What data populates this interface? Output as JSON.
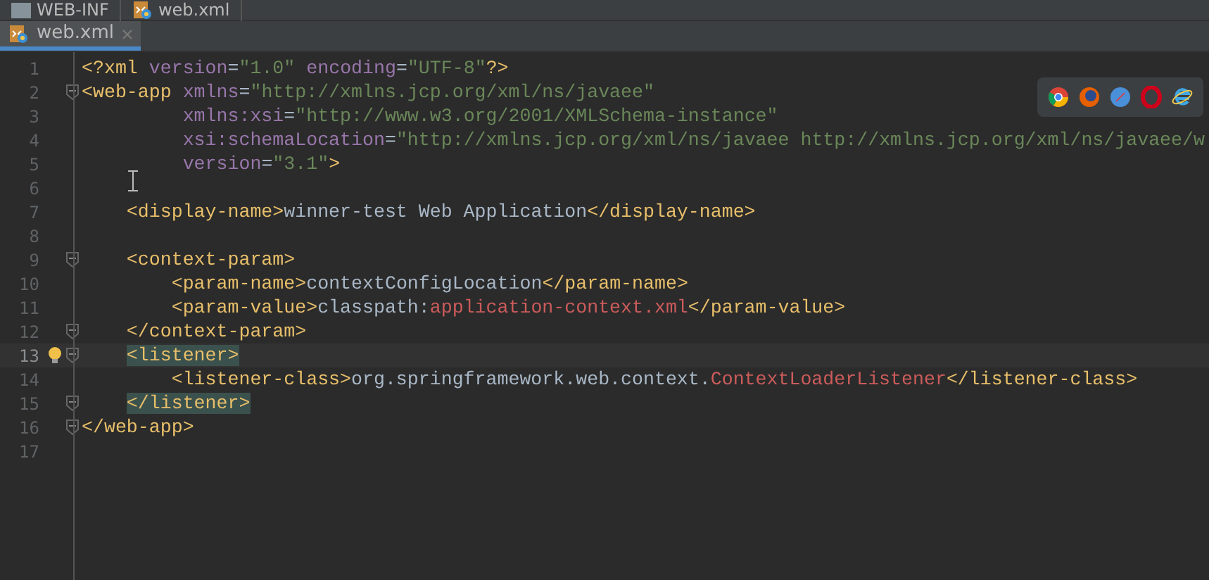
{
  "breadcrumbs": [
    {
      "label": "WEB-INF",
      "kind": "folder"
    },
    {
      "label": "web.xml",
      "kind": "file"
    }
  ],
  "tabs": [
    {
      "label": "web.xml",
      "selected": true
    }
  ],
  "lines": [
    {
      "number": "1",
      "fold": false,
      "current": false,
      "tokens": [
        {
          "kind": "tag",
          "text": "<?xml "
        },
        {
          "kind": "attr",
          "text": "version"
        },
        {
          "kind": "text",
          "text": "="
        },
        {
          "kind": "string",
          "text": "\"1.0\" "
        },
        {
          "kind": "attr",
          "text": "encoding"
        },
        {
          "kind": "text",
          "text": "="
        },
        {
          "kind": "string",
          "text": "\"UTF-8\""
        },
        {
          "kind": "tag",
          "text": "?>"
        }
      ]
    },
    {
      "number": "2",
      "fold": true,
      "current": false,
      "tokens": [
        {
          "kind": "tag",
          "text": "<web-app "
        },
        {
          "kind": "attr",
          "text": "xmlns"
        },
        {
          "kind": "text",
          "text": "="
        },
        {
          "kind": "string",
          "text": "\"http://xmlns.jcp.org/xml/ns/javaee\""
        }
      ]
    },
    {
      "number": "3",
      "fold": false,
      "current": false,
      "tokens": [
        {
          "kind": "attr",
          "text": "         xmlns:xsi"
        },
        {
          "kind": "text",
          "text": "="
        },
        {
          "kind": "string",
          "text": "\"http://www.w3.org/2001/XMLSchema-instance\""
        }
      ]
    },
    {
      "number": "4",
      "fold": false,
      "current": false,
      "tokens": [
        {
          "kind": "attr",
          "text": "         xsi:schemaLocation"
        },
        {
          "kind": "text",
          "text": "="
        },
        {
          "kind": "string",
          "text": "\"http://xmlns.jcp.org/xml/ns/javaee http://xmlns.jcp.org/xml/ns/javaee/w"
        }
      ]
    },
    {
      "number": "5",
      "fold": false,
      "current": false,
      "tokens": [
        {
          "kind": "attr",
          "text": "         version"
        },
        {
          "kind": "text",
          "text": "="
        },
        {
          "kind": "string",
          "text": "\"3.1\""
        },
        {
          "kind": "tag",
          "text": ">"
        }
      ]
    },
    {
      "number": "6",
      "fold": false,
      "current": false
    },
    {
      "number": "7",
      "fold": false,
      "current": false,
      "tokens": [
        {
          "kind": "tag",
          "text": "    <display-name>"
        },
        {
          "kind": "text",
          "text": "winner-test Web Application"
        },
        {
          "kind": "tag",
          "text": "</display-name>"
        }
      ]
    },
    {
      "number": "8",
      "fold": false,
      "current": false
    },
    {
      "number": "9",
      "fold": true,
      "current": false,
      "tokens": [
        {
          "kind": "tag",
          "text": "    <context-param>"
        }
      ]
    },
    {
      "number": "10",
      "fold": false,
      "current": false,
      "tokens": [
        {
          "kind": "tag",
          "text": "        <param-name>"
        },
        {
          "kind": "text",
          "text": "contextConfigLocation"
        },
        {
          "kind": "tag",
          "text": "</param-name>"
        }
      ]
    },
    {
      "number": "11",
      "fold": false,
      "current": false,
      "tokens": [
        {
          "kind": "tag",
          "text": "        <param-value>"
        },
        {
          "kind": "text",
          "text": "classpath:"
        },
        {
          "kind": "error",
          "text": "application-context.xml"
        },
        {
          "kind": "tag",
          "text": "</param-value>"
        }
      ]
    },
    {
      "number": "12",
      "fold": true,
      "current": false,
      "tokens": [
        {
          "kind": "tag",
          "text": "    </context-param>"
        }
      ]
    },
    {
      "number": "13",
      "fold": true,
      "current": true,
      "bulb": true,
      "tokens": [
        {
          "kind": "tag",
          "text": "    <listener>",
          "matched": true
        }
      ]
    },
    {
      "number": "14",
      "fold": false,
      "current": false,
      "tokens": [
        {
          "kind": "tag",
          "text": "        <listener-class>"
        },
        {
          "kind": "text",
          "text": "org.springframework.web.context."
        },
        {
          "kind": "error",
          "text": "ContextLoaderListener"
        },
        {
          "kind": "tag",
          "text": "</listener-class>"
        }
      ]
    },
    {
      "number": "15",
      "fold": true,
      "current": false,
      "tokens": [
        {
          "kind": "tag",
          "text": "    </listener>",
          "matched": true
        }
      ]
    },
    {
      "number": "16",
      "fold": true,
      "current": false,
      "tokens": [
        {
          "kind": "tag",
          "text": "</web-app>"
        }
      ]
    },
    {
      "number": "17",
      "fold": false,
      "current": false
    }
  ]
}
